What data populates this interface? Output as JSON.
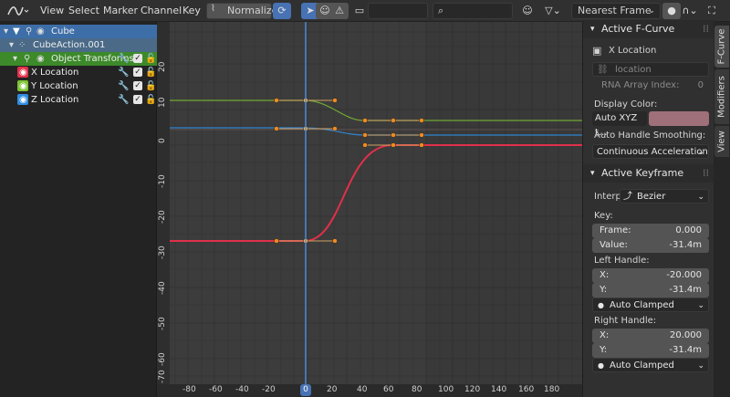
{
  "header": {
    "menus": [
      "View",
      "Select",
      "Marker",
      "Channel",
      "Key"
    ],
    "normalize_label": "Normalize",
    "interpolation_label": "Nearest Frame"
  },
  "channels": {
    "object": "Cube",
    "action": "CubeAction.001",
    "group": "Object Transforms",
    "curves": [
      {
        "label": "X Location",
        "color": "#e0304a"
      },
      {
        "label": "Y Location",
        "color": "#7ec434"
      },
      {
        "label": "Z Location",
        "color": "#2f8de0"
      }
    ]
  },
  "graph": {
    "x_ticks": [
      "-80",
      "-60",
      "-40",
      "-20",
      "0",
      "20",
      "40",
      "60",
      "80",
      "100",
      "120",
      "140",
      "160",
      "180"
    ],
    "y_ticks": [
      "20",
      "10",
      "0",
      "-10",
      "-20",
      "-30",
      "-40",
      "-50",
      "-60",
      "-70"
    ],
    "current_frame": "0"
  },
  "sidebar": {
    "tabs": [
      "F-Curve",
      "Modifiers",
      "View"
    ],
    "active_fcurve": {
      "title": "Active F-Curve",
      "curve_name": "X Location",
      "rna_placeholder": "location",
      "rna_index_label": "RNA Array Index:",
      "rna_index_value": "0",
      "display_color_label": "Display Color:",
      "display_color_mode": "Auto XYZ t...",
      "display_color_swatch": "#a0707a",
      "smoothing_label": "Auto Handle Smoothing:",
      "smoothing_value": "Continuous Acceleration"
    },
    "active_keyframe": {
      "title": "Active Keyframe",
      "interp_label": "Interp",
      "interp_value": "Bezier",
      "key_label": "Key:",
      "frame_label": "Frame:",
      "frame_value": "0.000",
      "value_label": "Value:",
      "value_value": "-31.4m",
      "left_handle_label": "Left Handle:",
      "lh_x_label": "X:",
      "lh_x_value": "-20.000",
      "lh_y_label": "Y:",
      "lh_y_value": "-31.4m",
      "lh_type": "Auto Clamped",
      "right_handle_label": "Right Handle:",
      "rh_x_label": "X:",
      "rh_x_value": "20.000",
      "rh_y_label": "Y:",
      "rh_y_value": "-31.4m",
      "rh_type": "Auto Clamped"
    }
  }
}
